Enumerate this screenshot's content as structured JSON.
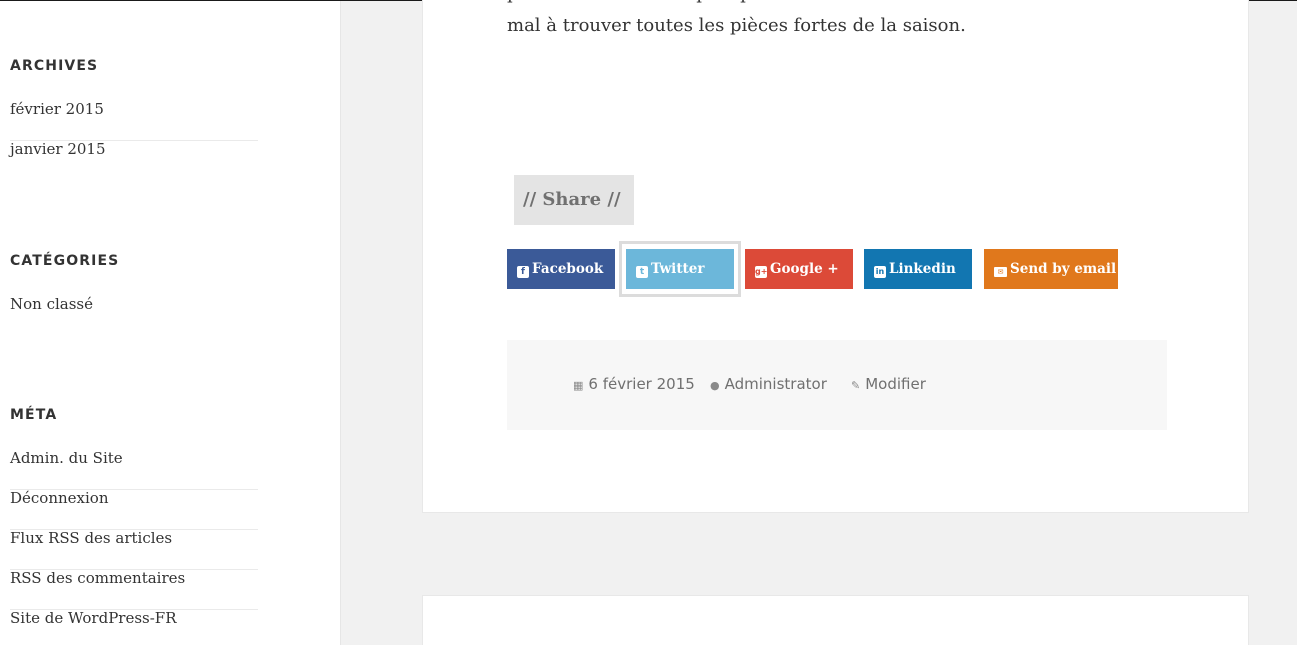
{
  "sidebar": {
    "archives": {
      "title": "ARCHIVES",
      "items": [
        "février 2015",
        "janvier 2015"
      ]
    },
    "categories": {
      "title": "CATÉGORIES",
      "items": [
        "Non classé"
      ]
    },
    "meta": {
      "title": "MÉTA",
      "items": [
        "Admin. du Site",
        "Déconnexion",
        "Flux RSS des articles",
        "RSS des commentaires",
        "Site de WordPress-FR"
      ]
    }
  },
  "post": {
    "paragraph": "pido. Ca tombe bien puisque dans notre collection vous n’aurez aucun mal à trouver toutes les pièces fortes de la saison.",
    "share_title": "// Share //",
    "share_buttons": {
      "facebook": {
        "label": "Facebook",
        "icon": "facebook-icon",
        "color": "#3b5a98"
      },
      "twitter": {
        "label": "Twitter",
        "icon": "twitter-icon",
        "color": "#6cb7da"
      },
      "google": {
        "label": "Google +",
        "icon": "google-plus-icon",
        "color": "#dc4a38"
      },
      "linkedin": {
        "label": "Linkedin",
        "icon": "linkedin-icon",
        "color": "#1276b1"
      },
      "email": {
        "label": "Send by email",
        "icon": "envelope-icon",
        "color": "#e0781c"
      }
    },
    "footer": {
      "date": "6 février 2015",
      "author": "Administrator",
      "edit": "Modifier"
    }
  }
}
